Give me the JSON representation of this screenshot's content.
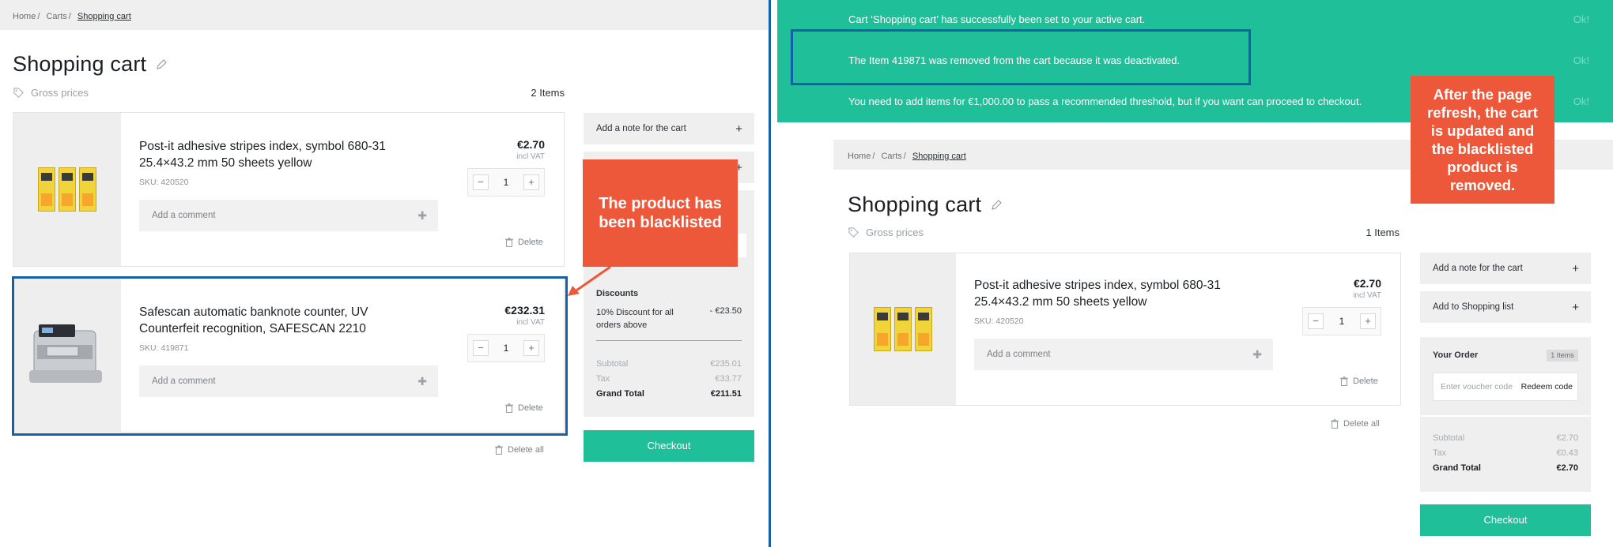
{
  "left": {
    "breadcrumb": [
      "Home",
      "Carts",
      "Shopping cart"
    ],
    "title": "Shopping cart",
    "gross_label": "Gross prices",
    "item_count": "2 Items",
    "items": [
      {
        "name_line1": "Post-it adhesive stripes index, symbol 680-31",
        "name_line2": "25.4×43.2 mm 50 sheets yellow",
        "sku": "SKU: 420520",
        "comment_placeholder": "Add a comment",
        "price": "€2.70",
        "vat": "incl VAT",
        "qty": "1",
        "delete": "Delete"
      },
      {
        "name_line1": "Safescan automatic banknote counter, UV",
        "name_line2": "Counterfeit recognition, SAFESCAN 2210",
        "sku": "SKU: 419871",
        "comment_placeholder": "Add a comment",
        "price": "€232.31",
        "vat": "incl VAT",
        "qty": "1",
        "delete": "Delete"
      }
    ],
    "delete_all": "Delete all",
    "sidebar": {
      "note": "Add a note for the cart",
      "discounts_title": "Discounts",
      "discount_line1": "10% Discount for all",
      "discount_line2": "orders above",
      "discount_value": "- €23.50",
      "subtotal_label": "Subtotal",
      "subtotal_value": "€235.01",
      "tax_label": "Tax",
      "tax_value": "€33.77",
      "grand_label": "Grand Total",
      "grand_value": "€211.51",
      "checkout": "Checkout"
    },
    "callout": "The product has been blacklisted"
  },
  "right": {
    "notices": [
      "Cart ‘Shopping cart’ has successfully been set to your active cart.",
      "The Item 419871 was removed from the cart because it was deactivated.",
      "You need to add items for €1,000.00 to pass a recommended threshold, but if you want can proceed to checkout."
    ],
    "ok": "Ok!",
    "breadcrumb": [
      "Home",
      "Carts",
      "Shopping cart"
    ],
    "title": "Shopping cart",
    "gross_label": "Gross prices",
    "item_count": "1 Items",
    "item": {
      "name_line1": "Post-it adhesive stripes index, symbol 680-31",
      "name_line2": "25.4×43.2 mm 50 sheets yellow",
      "sku": "SKU: 420520",
      "comment_placeholder": "Add a comment",
      "price": "€2.70",
      "vat": "incl VAT",
      "qty": "1",
      "delete": "Delete"
    },
    "delete_all": "Delete all",
    "sidebar": {
      "note": "Add a note for the cart",
      "shopping_list": "Add to Shopping list",
      "order_title": "Your Order",
      "order_badge": "1 Items",
      "voucher_placeholder": "Enter voucher code",
      "redeem": "Redeem code",
      "subtotal_label": "Subtotal",
      "subtotal_value": "€2.70",
      "tax_label": "Tax",
      "tax_value": "€0.43",
      "grand_label": "Grand Total",
      "grand_value": "€2.70",
      "checkout": "Checkout"
    },
    "callout": "After the page refresh, the cart is updated and the blacklisted product is removed."
  },
  "colors": {
    "accent": "#1fbf9a",
    "callout": "#ec5839",
    "highlight": "#1560aa"
  }
}
